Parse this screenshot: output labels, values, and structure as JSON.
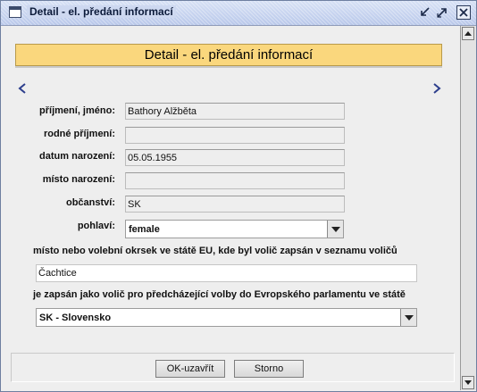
{
  "window": {
    "title": "Detail - el. předání informací"
  },
  "header": {
    "title": "Detail - el. předání informací",
    "color": "#fad77d"
  },
  "form": {
    "surname_label": "příjmení, jméno:",
    "surname_value": "Bathory Alžběta",
    "birth_surname_label": "rodné příjmení:",
    "birth_surname_value": "",
    "birth_date_label": "datum narození:",
    "birth_date_value": "05.05.1955",
    "birth_place_label": "místo narození:",
    "birth_place_value": "",
    "citizenship_label": "občanství:",
    "citizenship_value": "SK",
    "gender_label": "pohlaví:",
    "gender_value": "female",
    "district_label": "místo nebo volební okrsek ve státě EU, kde byl volič zapsán v seznamu voličů",
    "district_value": "Čachtice",
    "prev_state_label": "je zapsán jako volič pro předcházející volby do Evropského parlamentu ve státě",
    "prev_state_value": "SK - Slovensko"
  },
  "buttons": {
    "ok_label": "OK-uzavřít",
    "cancel_label": "Storno"
  },
  "icons": {
    "app": "window-icon",
    "minimize": "minimize-icon",
    "maximize": "maximize-icon",
    "close": "close-icon",
    "prev": "chevron-left-icon",
    "next": "chevron-right-icon"
  }
}
